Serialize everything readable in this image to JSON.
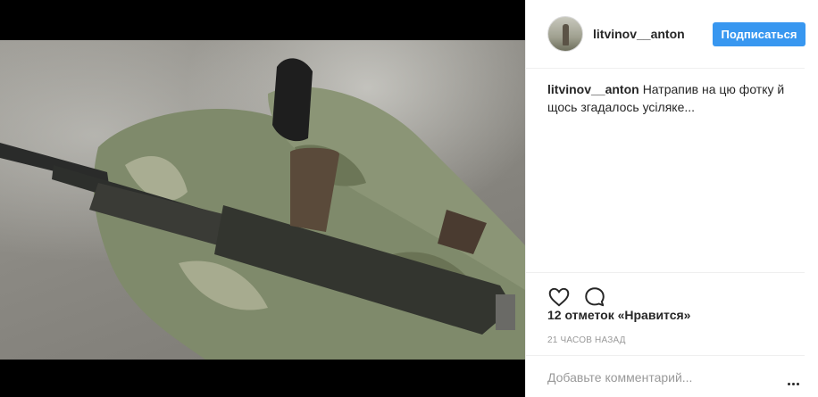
{
  "post": {
    "photo_alt": "",
    "author": {
      "username": "litvinov__anton",
      "follow_label": "Подписаться"
    },
    "caption": {
      "username": "litvinov__anton",
      "text": "Натрапив на цю фотку й щось згадалось усіляке..."
    },
    "icons": {
      "like": "heart-icon",
      "comment": "comment-bubble-icon",
      "more": "more-options-icon"
    },
    "likes_text": "12 отметок «Нравится»",
    "timestamp": "21 часов назад",
    "comment": {
      "placeholder": "Добавьте комментарий...",
      "value": ""
    },
    "colors": {
      "accent": "#3897f0",
      "text": "#262626",
      "muted": "#999999",
      "divider": "#efefef"
    }
  }
}
